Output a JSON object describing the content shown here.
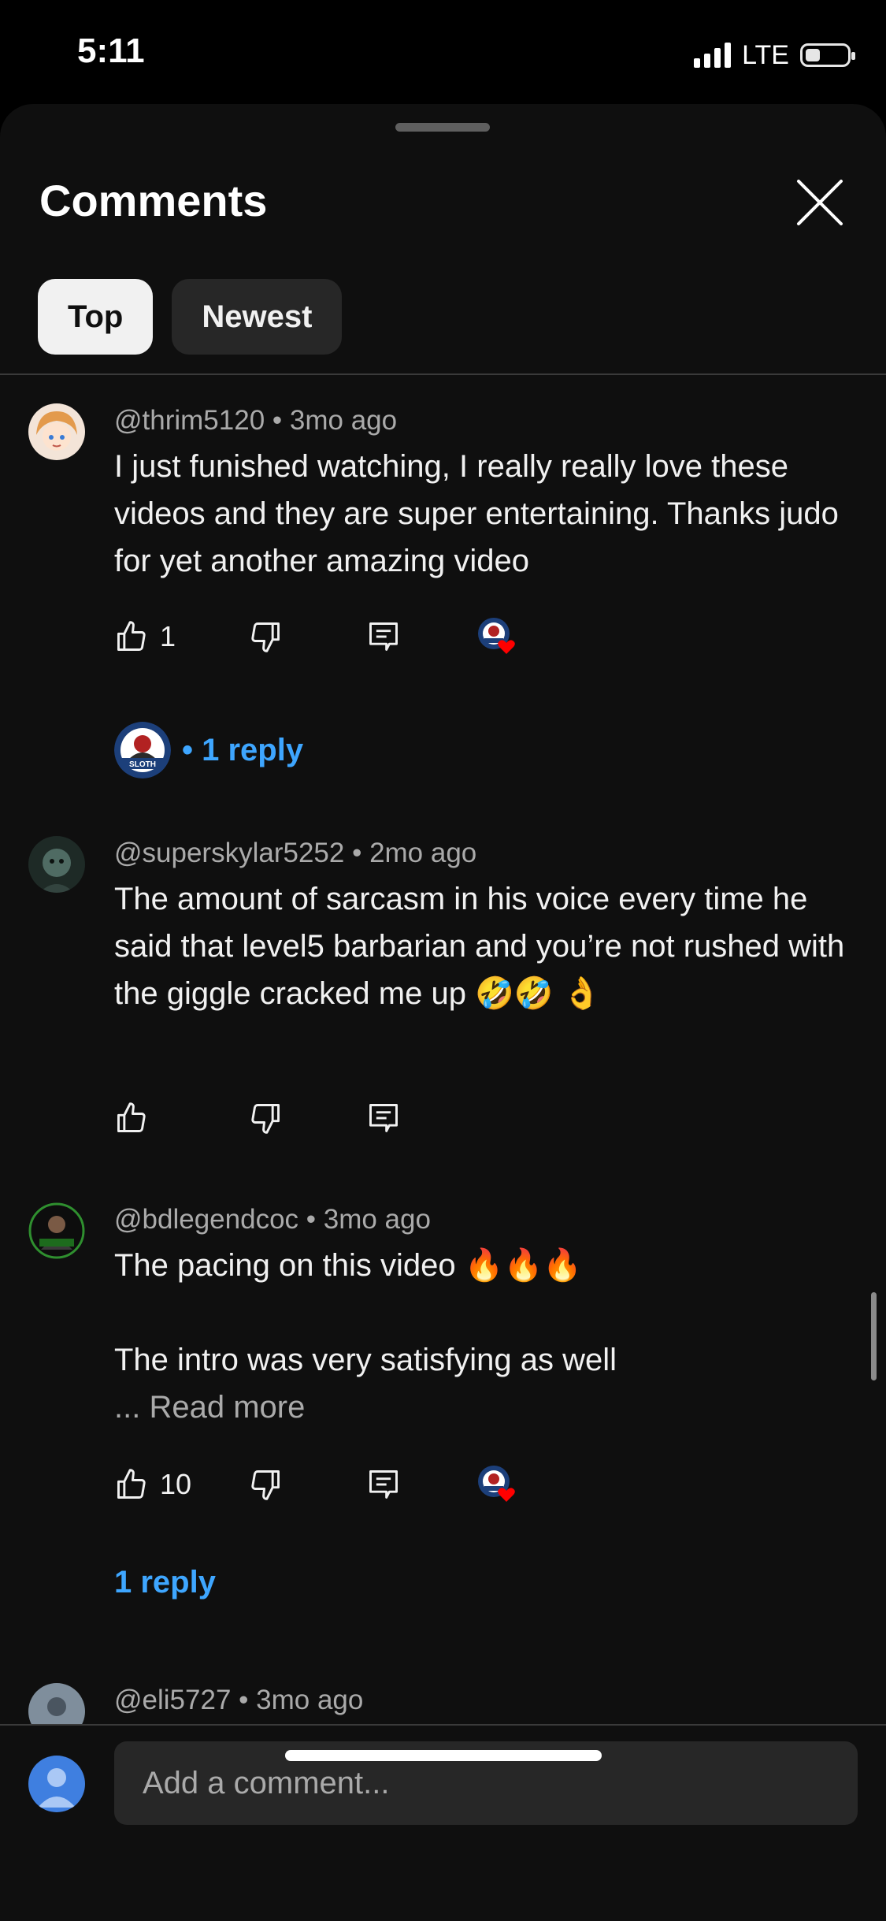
{
  "status_bar": {
    "time": "5:11",
    "network": "LTE"
  },
  "sheet": {
    "title": "Comments",
    "close_icon": "close-icon",
    "tabs": [
      {
        "label": "Top",
        "active": true
      },
      {
        "label": "Newest",
        "active": false
      }
    ]
  },
  "comments": [
    {
      "author": "@thrim5120",
      "age": "3mo ago",
      "text": "I just funished watching, I really really love these videos and they are super entertaining. Thanks judo for yet another amazing video",
      "likes": "1",
      "creator_hearted": true,
      "replies_label": "• 1 reply"
    },
    {
      "author": "@superskylar5252",
      "age": "2mo ago",
      "text": "The amount of sarcasm in his voice every time he said that level5 barbarian and you’re not rushed with the giggle cracked me up 🤣🤣 👌",
      "likes": "",
      "creator_hearted": false
    },
    {
      "author": "@bdlegendcoc",
      "age": "3mo ago",
      "text_line1": "The pacing on this video 🔥🔥🔥",
      "text_line2": "The intro was very satisfying as well",
      "read_more": "... Read more",
      "likes": "10",
      "creator_hearted": true,
      "replies_label": "1 reply"
    },
    {
      "author": "@eli5727",
      "age": "3mo ago"
    }
  ],
  "composer": {
    "placeholder": "Add a comment..."
  },
  "colors": {
    "sheet_bg": "#0f0f0f",
    "chip_active": "#f1f1f1",
    "chip_inactive": "#272727",
    "link_blue": "#3ea6ff",
    "muted_text": "#aaaaaa",
    "heart_red": "#ff0000"
  }
}
